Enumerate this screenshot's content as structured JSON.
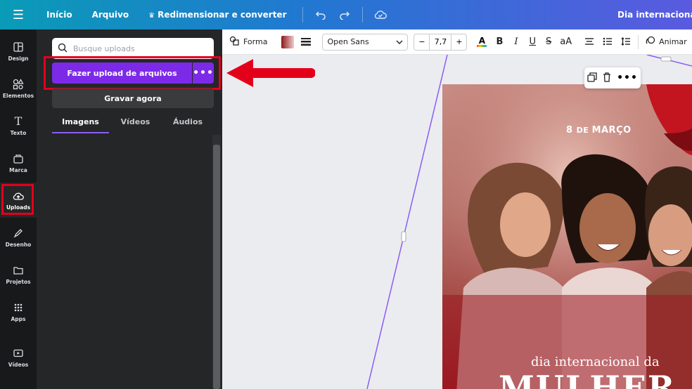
{
  "topbar": {
    "home": "Início",
    "file": "Arquivo",
    "resize": "Redimensionar e converter",
    "doc_title": "Dia internacional da mulher"
  },
  "rail": {
    "items": [
      {
        "label": "Design"
      },
      {
        "label": "Elementos"
      },
      {
        "label": "Texto"
      },
      {
        "label": "Marca"
      },
      {
        "label": "Uploads"
      },
      {
        "label": "Desenho"
      },
      {
        "label": "Projetos"
      },
      {
        "label": "Apps"
      },
      {
        "label": "Vídeos"
      }
    ]
  },
  "panel": {
    "search_placeholder": "Busque uploads",
    "upload_label": "Fazer upload de arquivos",
    "more_label": "•••",
    "record_label": "Gravar agora",
    "tabs": [
      {
        "label": "Imagens"
      },
      {
        "label": "Vídeos"
      },
      {
        "label": "Áudios"
      }
    ]
  },
  "toolbar": {
    "shape_label": "Forma",
    "font_name": "Open Sans",
    "font_size": "7,7",
    "minus": "−",
    "plus": "+",
    "bold": "B",
    "italic": "I",
    "underline": "U",
    "strike": "S",
    "case": "aA",
    "animate_label": "Animar"
  },
  "design": {
    "date_main": "8 ",
    "date_small": "DE ",
    "date_month": "MARÇO",
    "headline": "dia internacional da",
    "big_word": "MULHER"
  },
  "colors": {
    "accent": "#7d2ae8",
    "highlight": "#e3001b"
  }
}
